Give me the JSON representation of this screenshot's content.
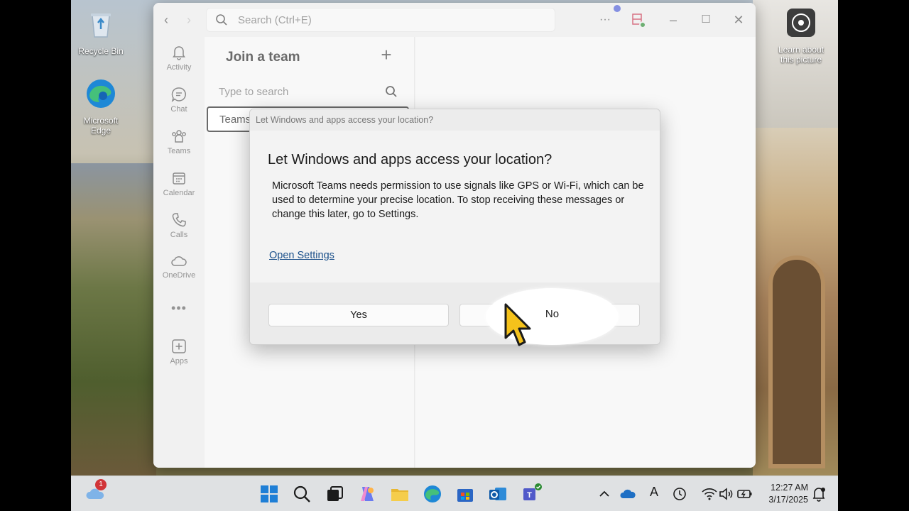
{
  "desktop": {
    "icons": [
      {
        "label": "Recycle Bin"
      },
      {
        "label": "Microsoft Edge"
      },
      {
        "label": "Learn about this picture"
      }
    ]
  },
  "window": {
    "search_placeholder": "Search (Ctrl+E)",
    "rail": [
      {
        "label": "Activity"
      },
      {
        "label": "Chat"
      },
      {
        "label": "Teams"
      },
      {
        "label": "Calendar"
      },
      {
        "label": "Calls"
      },
      {
        "label": "OneDrive"
      },
      {
        "label": "Apps"
      }
    ],
    "left_pane": {
      "title": "Join a team",
      "search_placeholder": "Type to search",
      "tab_label": "Teams"
    }
  },
  "dialog": {
    "caption": "Let Windows and apps access your location?",
    "title": "Let Windows and apps access your location?",
    "body": "Microsoft Teams needs permission to use signals like GPS or Wi-Fi, which can be used to determine your precise location. To stop receiving these messages or change this later, go to Settings.",
    "link": "Open Settings",
    "yes_label": "Yes",
    "no_label": "No"
  },
  "taskbar": {
    "weather_badge": "1",
    "time": "12:27 AM",
    "date": "3/17/2025"
  },
  "colors": {
    "accent": "#1a4f8a",
    "presence": "#2a8a32",
    "badge": "#d13438"
  }
}
